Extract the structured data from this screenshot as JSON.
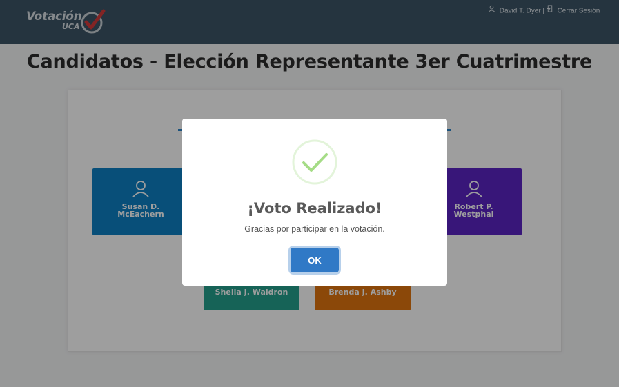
{
  "header": {
    "logo_text": "Votación",
    "logo_sub": "UCA",
    "user_name": "David T. Dyer",
    "separator": "|",
    "logout_label": "Cerrar Sesión"
  },
  "page": {
    "title": "Candidatos - Elección Representante 3er Cuatrimestre"
  },
  "candidates": [
    {
      "name": "Susan D. McEachern",
      "color": "#0d80c4"
    },
    {
      "name": "Robert P. Westphal",
      "color": "#5b24c4"
    },
    {
      "name": "Sheila J. Waldron",
      "color": "#24a08d"
    },
    {
      "name": "Brenda J. Ashby",
      "color": "#e0740f"
    }
  ],
  "modal": {
    "icon": "success-check-icon",
    "title": "¡Voto Realizado!",
    "message": "Gracias por participar en la votación.",
    "ok_label": "OK"
  },
  "colors": {
    "topbar": "#3c5466",
    "accent": "#2a84c8",
    "success": "#a5dc86"
  }
}
